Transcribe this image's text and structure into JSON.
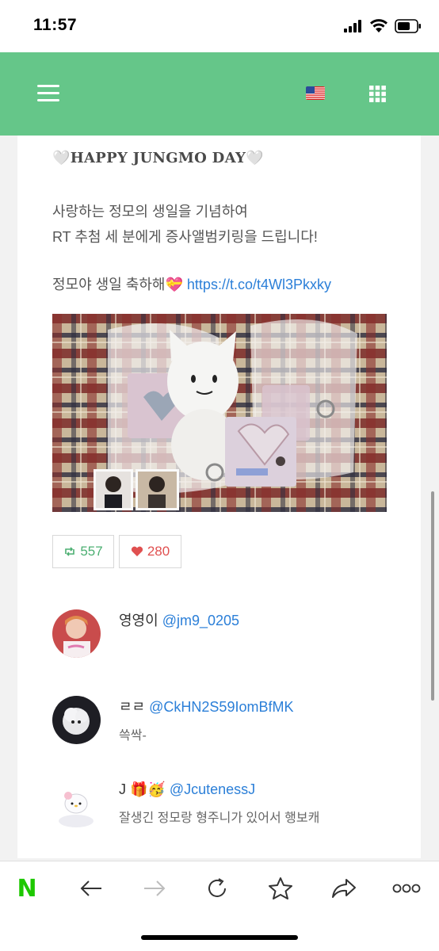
{
  "status_bar": {
    "time": "11:57"
  },
  "header": {
    "menu_icon": "hamburger-menu-icon",
    "language_icon": "us-flag-icon",
    "apps_icon": "grid-icon",
    "accent_color": "#65c689"
  },
  "tweet": {
    "title": "🤍HAPPY JUNGMO DAY🤍",
    "line1": "사랑하는 정모의 생일을 기념하여",
    "line2": "RT 추첨 세 분에게 증사앨범키링을 드립니다!",
    "line3_text": "정모야 생일 축하해💝",
    "link": "https://t.co/t4Wl3Pkxky",
    "retweet_count": "557",
    "like_count": "280"
  },
  "replies": [
    {
      "name": "영영이",
      "handle": "@jm9_0205",
      "text": ""
    },
    {
      "name": "ㄹㄹ",
      "handle": "@CkHN2S59IomBfMK",
      "text": "쓱싹-"
    },
    {
      "name": "J 🎁🥳",
      "handle": "@JcutenessJ",
      "text": "잘생긴 정모랑 형주니가 있어서 행보캐"
    }
  ],
  "toolbar": {
    "logo": "N",
    "items": [
      "naver-logo",
      "back-arrow-icon",
      "forward-arrow-icon",
      "refresh-icon",
      "bookmark-star-icon",
      "share-icon",
      "more-icon"
    ]
  }
}
